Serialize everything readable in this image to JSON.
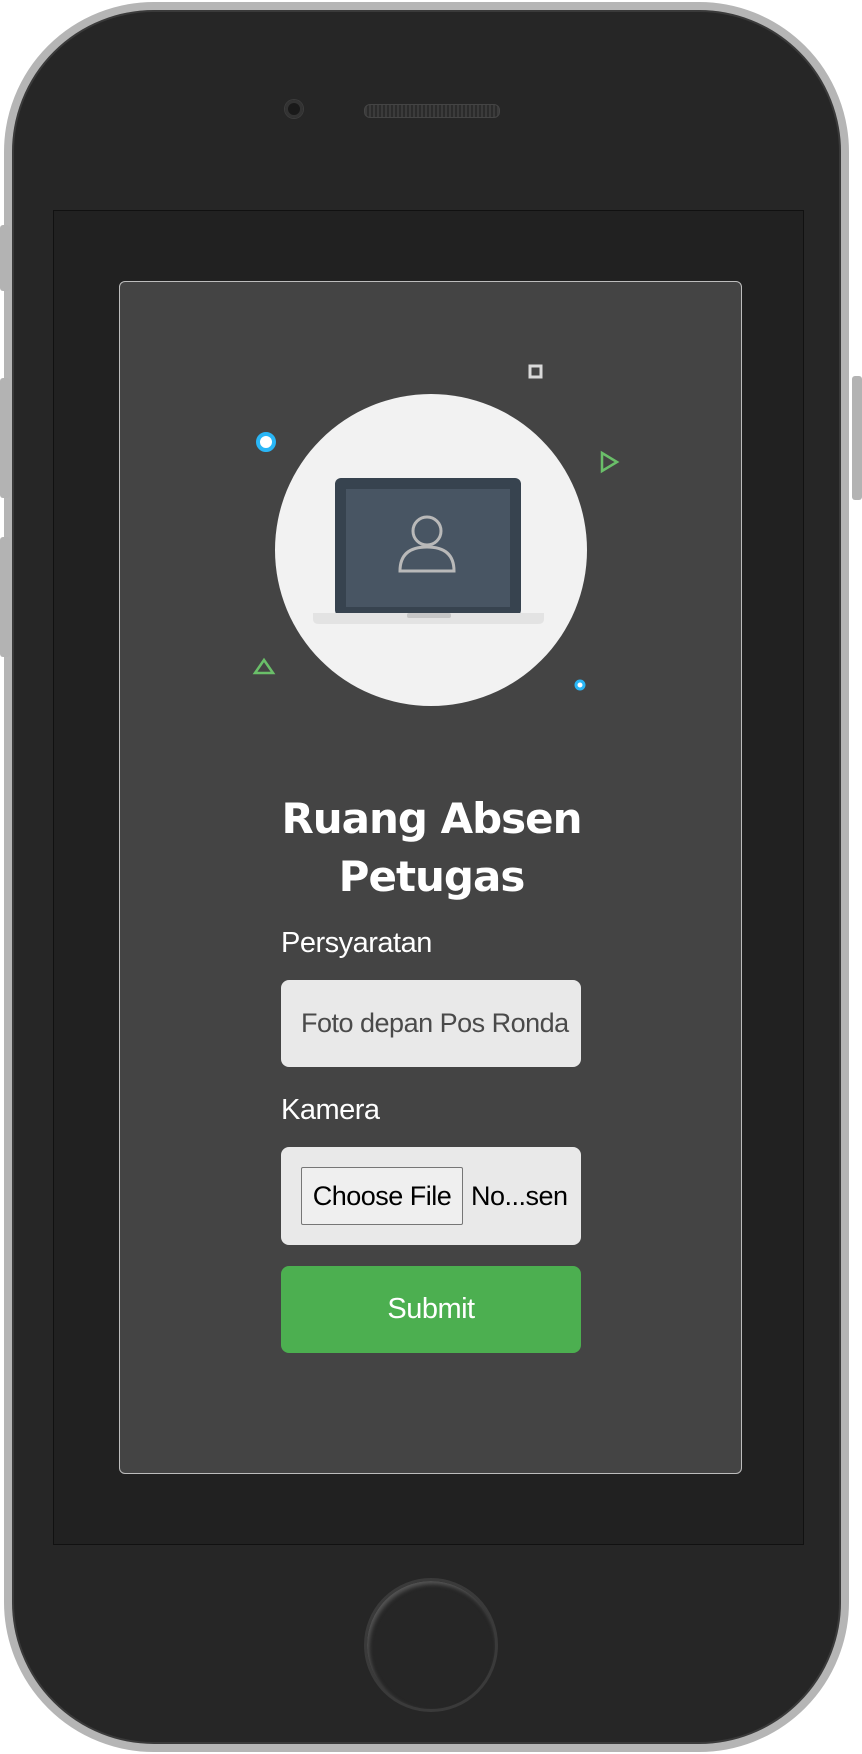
{
  "page": {
    "title_line1": "Ruang Absen",
    "title_line2": "Petugas"
  },
  "form": {
    "requirement_label": "Persyaratan",
    "requirement_value": "Foto depan Pos Ronda",
    "camera_label": "Kamera",
    "choose_file_label": "Choose File",
    "file_status": "No...sen",
    "submit_label": "Submit"
  },
  "colors": {
    "card_bg": "#444444",
    "submit_bg": "#4caf50",
    "accent_blue": "#29b6f6",
    "accent_green": "#6abf69"
  },
  "icons": [
    "laptop-user-icon",
    "circle-accent-icon",
    "square-accent-icon",
    "triangle-accent-icon",
    "play-triangle-accent-icon",
    "dot-accent-icon"
  ]
}
